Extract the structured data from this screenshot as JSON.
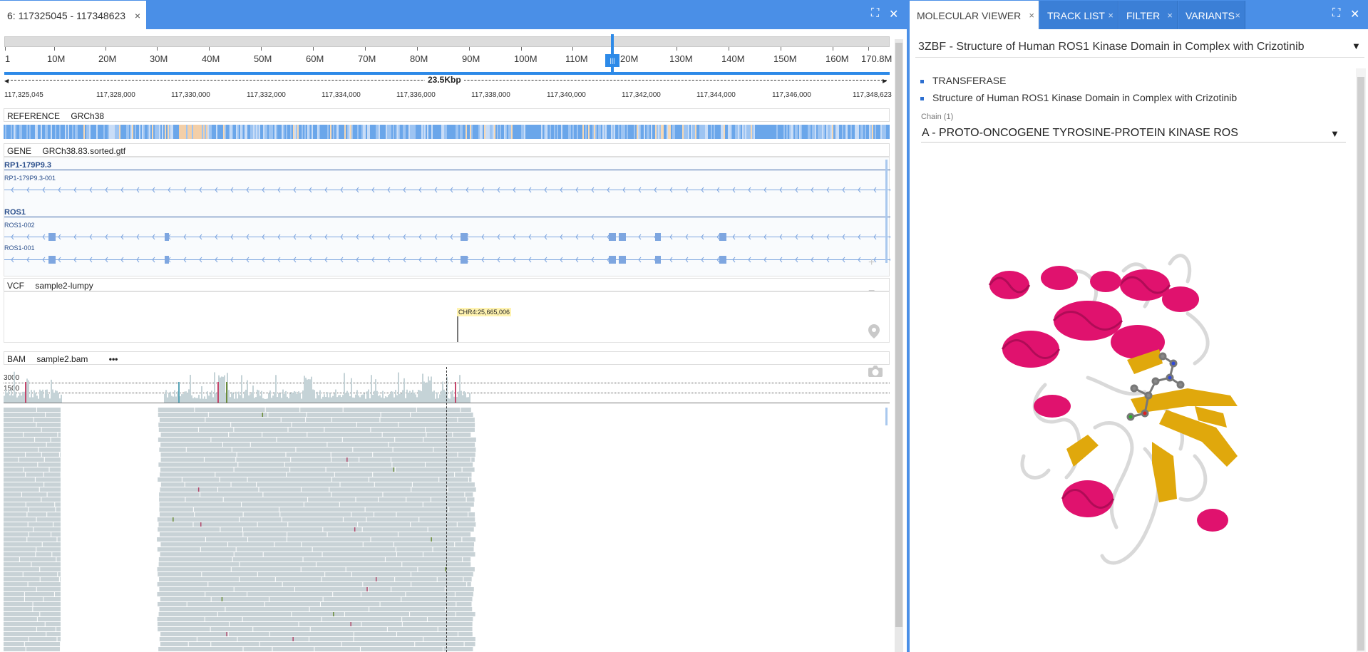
{
  "left_window": {
    "tab_title": "6: 117325045 - 117348623",
    "close_label": "×",
    "maximize_label": "⛶",
    "close_window_label": "✕"
  },
  "chromosome_ruler": {
    "labels": [
      "1",
      "10M",
      "20M",
      "30M",
      "40M",
      "50M",
      "60M",
      "70M",
      "80M",
      "90M",
      "100M",
      "110M",
      "120M",
      "130M",
      "140M",
      "150M",
      "160M",
      "170.8M"
    ],
    "cursor_label": "|||",
    "span_label": "23.5Kbp"
  },
  "coordinate_labels": [
    "117,325,045",
    "117,328,000",
    "117,330,000",
    "117,332,000",
    "117,334,000",
    "117,336,000",
    "117,338,000",
    "117,340,000",
    "117,342,000",
    "117,344,000",
    "117,346,000",
    "117,348,623"
  ],
  "tracks": {
    "reference": {
      "type": "REFERENCE",
      "name": "GRCh38"
    },
    "gene": {
      "type": "GENE",
      "name": "GRCh38.83.sorted.gtf",
      "genes": [
        {
          "name": "RP1-179P9.3",
          "transcripts": [
            "RP1-179P9.3-001"
          ]
        },
        {
          "name": "ROS1",
          "transcripts": [
            "ROS1-002",
            "ROS1-001"
          ]
        }
      ]
    },
    "vcf": {
      "type": "VCF",
      "name": "sample2-lumpy",
      "variant_label": "CHR4:25,665,006"
    },
    "bam": {
      "type": "BAM",
      "name": "sample2.bam",
      "menu_label": "•••",
      "coverage_labels": [
        "3000",
        "1500"
      ]
    }
  },
  "side_icons": [
    "plus-icon",
    "minus-icon",
    "location-pin-icon",
    "camera-icon"
  ],
  "right_window": {
    "tabs": [
      {
        "label": "MOLECULAR VIEWER",
        "active": true
      },
      {
        "label": "TRACK LIST",
        "active": false
      },
      {
        "label": "FILTER",
        "active": false
      },
      {
        "label": "VARIANTS",
        "active": false
      }
    ],
    "tab_close": "×",
    "structure_title": "3ZBF  - Structure of Human ROS1 Kinase Domain in Complex with Crizotinib",
    "info_items": [
      "TRANSFERASE",
      "Structure of Human ROS1 Kinase Domain in Complex with Crizotinib"
    ],
    "chain_label": "Chain (1)",
    "chain_value": "A - PROTO-ONCOGENE TYROSINE-PROTEIN KINASE ROS",
    "caret": "▼"
  },
  "colors": {
    "accent_blue": "#4a8fe7",
    "helix_magenta": "#e0126e",
    "strand_gold": "#e0a80c",
    "coil_gray": "#d6d6d6"
  }
}
